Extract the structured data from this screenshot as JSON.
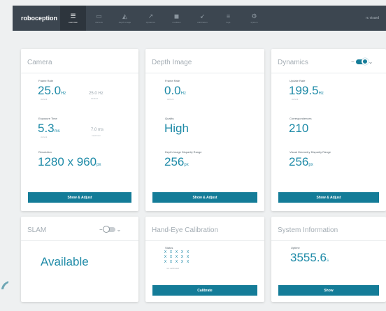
{
  "brand": "roboception",
  "nav": [
    {
      "icon": "list-icon",
      "glyph": "☰",
      "label": "overview",
      "active": true
    },
    {
      "icon": "camera-icon",
      "glyph": "▭",
      "label": "camera",
      "active": false
    },
    {
      "icon": "depth-icon",
      "glyph": "◭",
      "label": "depth image",
      "active": false
    },
    {
      "icon": "dynamics-icon",
      "glyph": "↗",
      "label": "dynamics",
      "active": false
    },
    {
      "icon": "modules-icon",
      "glyph": "◼",
      "label": "modules",
      "active": false
    },
    {
      "icon": "calibration-icon",
      "glyph": "↙",
      "label": "calibration",
      "active": false
    },
    {
      "icon": "logs-icon",
      "glyph": "≡",
      "label": "logs",
      "active": false
    },
    {
      "icon": "system-icon",
      "glyph": "⚙",
      "label": "system",
      "active": false
    }
  ],
  "status": "rc visard",
  "camera": {
    "title": "Camera",
    "frame_rate_label": "Frame Rate",
    "frame_rate_value": "25.0",
    "frame_rate_unit": "Hz",
    "frame_rate_sub": "current",
    "frame_rate_target": "25.0 Hz",
    "frame_rate_target_sub": "desired",
    "exposure_label": "Exposure Time",
    "exposure_value": "5.3",
    "exposure_unit": "ms",
    "exposure_sub": "current",
    "exposure_max": "7.0 ms",
    "exposure_max_sub": "maximum",
    "resolution_label": "Resolution",
    "resolution_value": "1280 x 960",
    "resolution_unit": "px",
    "button": "Show & Adjust"
  },
  "depth": {
    "title": "Depth Image",
    "frame_rate_label": "Frame Rate",
    "frame_rate_value": "0.0",
    "frame_rate_unit": "Hz",
    "frame_rate_sub": "current",
    "quality_label": "Quality",
    "quality_value": "High",
    "disparity_label": "Depth Image Disparity Range",
    "disparity_value": "256",
    "disparity_unit": "px",
    "button": "Show & Adjust"
  },
  "dynamics": {
    "title": "Dynamics",
    "toggle_on": true,
    "update_label": "Update Rate",
    "update_value": "199.5",
    "update_unit": "Hz",
    "update_sub": "current",
    "corr_label": "Correspondences",
    "corr_value": "210",
    "vo_label": "Visual Odometry Disparity Range",
    "vo_value": "256",
    "vo_unit": "px",
    "button": "Show & Adjust"
  },
  "slam": {
    "title": "SLAM",
    "toggle_on": false,
    "status": "Available"
  },
  "hand_eye": {
    "title": "Hand-Eye Calibration",
    "status_label": "Status",
    "pattern_rows": [
      "X X X X X",
      "X X X X X",
      "X X X X X"
    ],
    "pattern_sub": "not calibrated",
    "button": "Calibrate"
  },
  "system": {
    "title": "System Information",
    "uptime_label": "Uptime",
    "uptime_value": "3555.6",
    "uptime_unit": "s",
    "button": "Show"
  },
  "colors": {
    "accent": "#147c98",
    "value": "#1d8aa7",
    "topbar": "#3c4650"
  }
}
